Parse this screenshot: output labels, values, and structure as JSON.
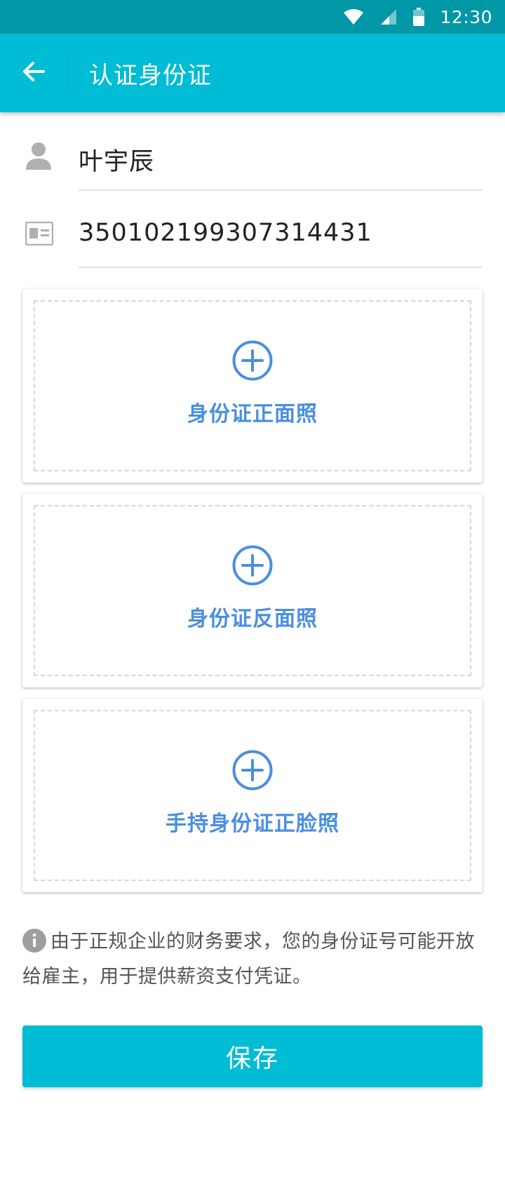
{
  "status_bar": {
    "time": "12:30",
    "icons": [
      "wifi-icon",
      "signal-icon",
      "battery-icon"
    ]
  },
  "app_bar": {
    "back_icon": "arrow-left-icon",
    "title": "认证身份证"
  },
  "form": {
    "name": {
      "icon": "person-icon",
      "value": "叶宇辰"
    },
    "id_number": {
      "icon": "id-card-icon",
      "value": "350102199307314431"
    }
  },
  "upload_cards": [
    {
      "icon": "plus-circle-icon",
      "label": "身份证正面照"
    },
    {
      "icon": "plus-circle-icon",
      "label": "身份证反面照"
    },
    {
      "icon": "plus-circle-icon",
      "label": "手持身份证正脸照"
    }
  ],
  "notice": {
    "icon": "info-icon",
    "text": "由于正规企业的财务要求，您的身份证号可能开放给雇主，用于提供薪资支付凭证。"
  },
  "save_button": {
    "label": "保存"
  },
  "colors": {
    "status_bar": "#0097a7",
    "primary": "#00bcd4",
    "accent_blue": "#4a8ee0",
    "icon_gray": "#b0b0b0"
  }
}
